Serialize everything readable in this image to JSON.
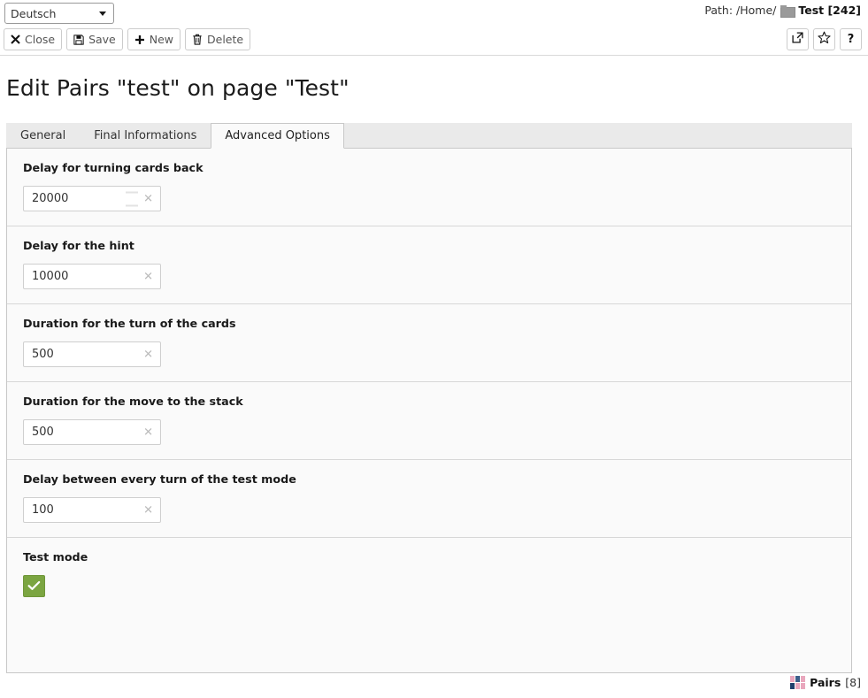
{
  "topbar": {
    "language_select": {
      "value": "Deutsch",
      "caret_icon": "chevron-down-icon"
    },
    "path": {
      "label": "Path: /Home/",
      "folder_icon": "folder-icon",
      "crumb": "Test [242]"
    },
    "buttons": [
      {
        "label": "Close",
        "icon": "close-x-icon"
      },
      {
        "label": "Save",
        "icon": "floppy-disk-icon"
      },
      {
        "label": "New",
        "icon": "plus-icon"
      },
      {
        "label": "Delete",
        "icon": "trash-icon"
      }
    ],
    "right_buttons": [
      {
        "name": "open-external-button",
        "icon": "external-link-icon",
        "label": ""
      },
      {
        "name": "favorite-button",
        "icon": "star-icon",
        "label": ""
      },
      {
        "name": "help-button",
        "icon": "question-mark-icon",
        "label": "?"
      }
    ]
  },
  "page_title": "Edit Pairs \"test\" on page \"Test\"",
  "tabs": [
    {
      "label": "General",
      "active": false
    },
    {
      "label": "Final Informations",
      "active": false
    },
    {
      "label": "Advanced Options",
      "active": true
    }
  ],
  "fields": [
    {
      "label": "Delay for turning cards back",
      "value": "20000",
      "placeholder": "",
      "has_spinner": true
    },
    {
      "label": "Delay for the hint",
      "value": "10000",
      "placeholder": "",
      "has_spinner": false
    },
    {
      "label": "Duration for the turn of the cards",
      "value": "500",
      "placeholder": "",
      "has_spinner": false
    },
    {
      "label": "Duration for the move to the stack",
      "value": "500",
      "placeholder": "",
      "has_spinner": false
    },
    {
      "label": "Delay between every turn of the test mode",
      "value": "100",
      "placeholder": "",
      "has_spinner": false
    }
  ],
  "toggle_field": {
    "label": "Test mode",
    "checked": true,
    "check_icon": "checkmark-icon",
    "color": "#7ba541"
  },
  "clear_icon": "clear-x-icon",
  "footer": {
    "icon": "pairs-cards-icon",
    "name": "Pairs",
    "count": "[8]"
  },
  "colors": {
    "panel_bg": "#fafafa",
    "tabstrip_bg": "#eaeaea",
    "border": "#c8c8c8",
    "checked_green": "#7ba541"
  }
}
